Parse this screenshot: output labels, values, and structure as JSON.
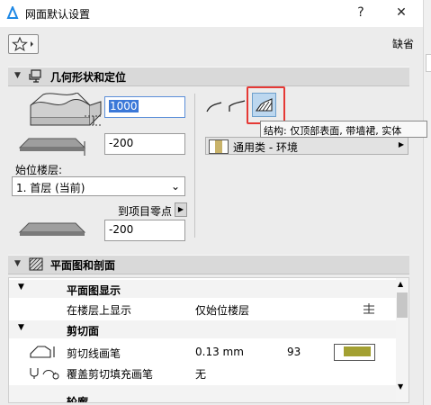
{
  "window": {
    "title": "网面默认设置",
    "help": "?",
    "close": "✕"
  },
  "toolbar": {
    "default_label": "缺省"
  },
  "geometry": {
    "title": "几何形状和定位",
    "thickness_value": "1000",
    "offset_value": "-200",
    "home_story_label": "始位楼层:",
    "home_story_value": "1. 首层 (当前)",
    "project_zero_label": "到项目零点",
    "project_zero_value": "-200",
    "surface_material": "通用类 - 环境",
    "tooltip": "结构: 仅顶部表面, 带墙裙, 实体"
  },
  "floorplan": {
    "title": "平面图和剖面",
    "rows": [
      {
        "label": "平面图显示",
        "value": "",
        "extra": ""
      },
      {
        "label": "在楼层上显示",
        "value": "仅始位楼层",
        "extra": ""
      },
      {
        "label": "剪切面",
        "value": "",
        "extra": ""
      },
      {
        "label": "剪切线画笔",
        "value": "0.13 mm",
        "extra": "93"
      },
      {
        "label": "覆盖剪切填充画笔",
        "value": "无",
        "extra": ""
      },
      {
        "label": "轮廓",
        "value": "",
        "extra": ""
      }
    ]
  },
  "colors": {
    "pen_swatch": "#a3a032",
    "highlight": "#e53935",
    "selection": "#3b78d8"
  }
}
